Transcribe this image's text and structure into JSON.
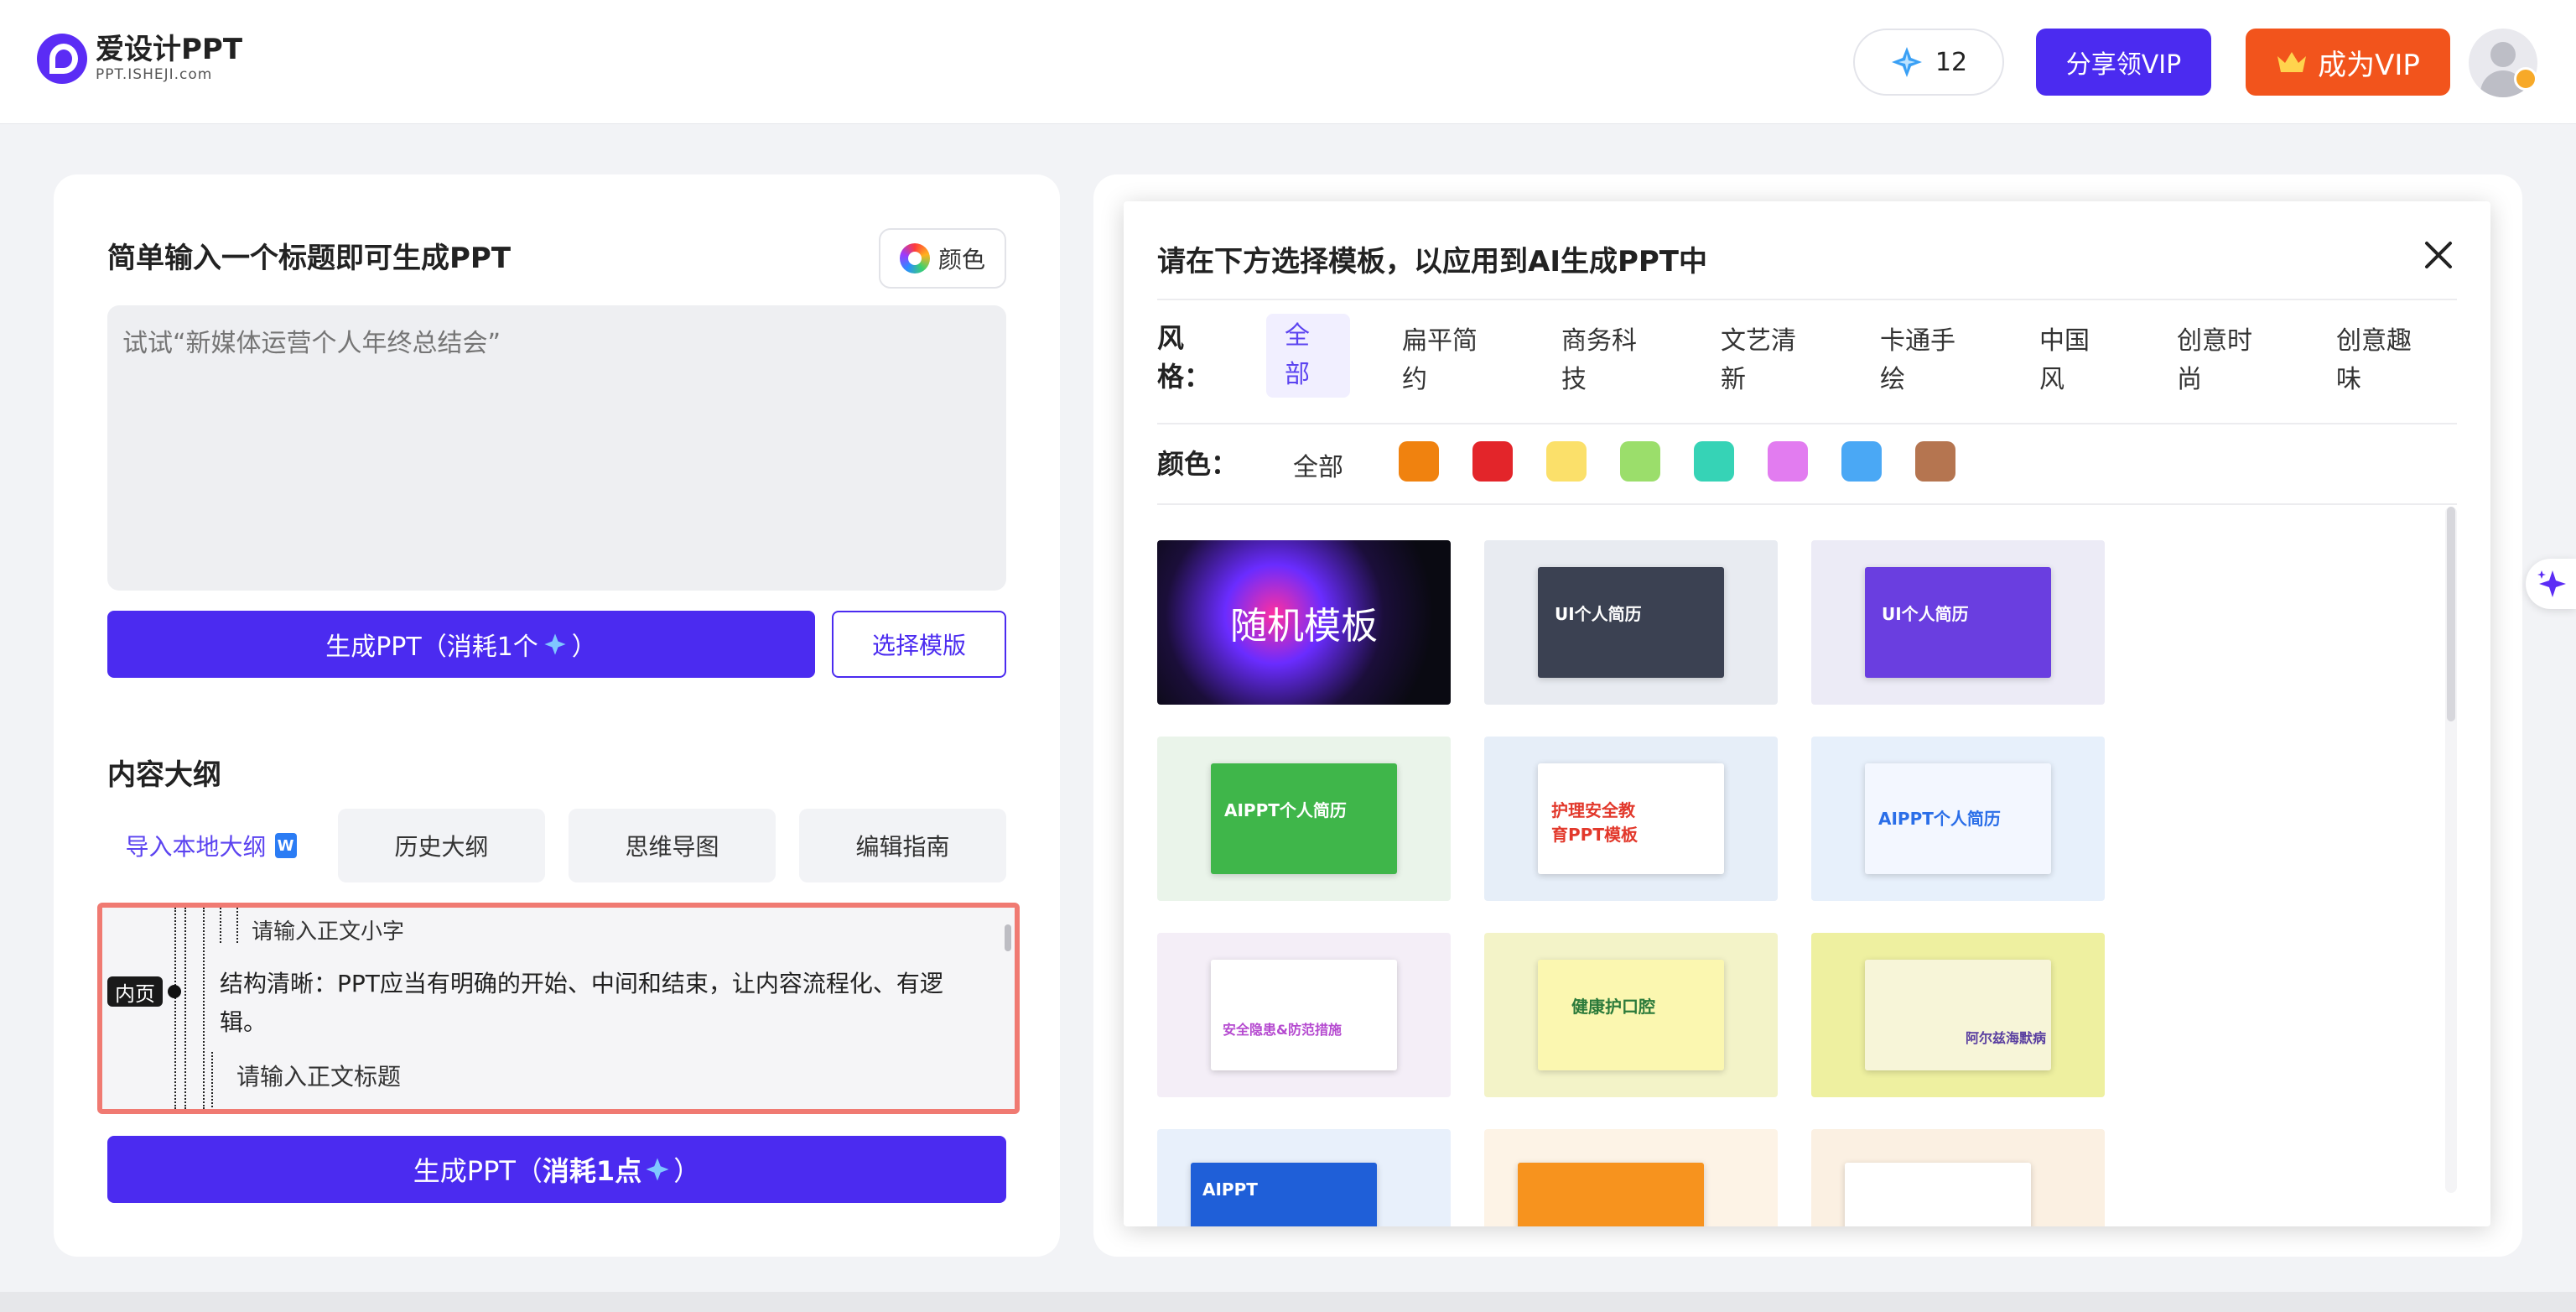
{
  "header": {
    "logo_cn": "爱设计PPT",
    "logo_en": "PPT.ISHEJI.com",
    "credits": "12",
    "share_button": "分享领VIP",
    "vip_button": "成为VIP"
  },
  "left": {
    "title": "简单输入一个标题即可生成PPT",
    "color_button": "颜色",
    "input_placeholder": "试试“新媒体运营个人年终总结会”",
    "generate_button": "生成PPT（消耗1个",
    "generate_button_tail": "）",
    "template_button": "选择模版",
    "outline_title": "内容大纲",
    "tabs": [
      {
        "label": "导入本地大纲"
      },
      {
        "label": "历史大纲"
      },
      {
        "label": "思维导图"
      },
      {
        "label": "编辑指南"
      }
    ],
    "outline": {
      "line1": "请输入正文小字",
      "line2": "结构清晰：PPT应当有明确的开始、中间和结束，让内容流程化、有逻辑。",
      "line3": "请输入正文标题",
      "badge": "内页"
    },
    "generate_button2": "生成PPT（",
    "generate_button2_bold": "消耗1点",
    "generate_button2_tail": "）"
  },
  "modal": {
    "title": "请在下方选择模板，以应用到AI生成PPT中",
    "style_label": "风格：",
    "styles": [
      "全部",
      "扁平简约",
      "商务科技",
      "文艺清新",
      "卡通手绘",
      "中国风",
      "创意时尚",
      "创意趣味"
    ],
    "color_label": "颜色：",
    "color_all": "全部",
    "colors": [
      "#f0820f",
      "#e3252a",
      "#fbe06a",
      "#9bde6b",
      "#36d3b6",
      "#e27cf0",
      "#4aa8f5",
      "#b57550"
    ],
    "random_template": "随机模板",
    "templates": [
      {
        "label": "UI个人简历"
      },
      {
        "label": "UI个人简历"
      },
      {
        "label": "AIPPT个人简历"
      },
      {
        "label": "护理安全教育PPT模板"
      },
      {
        "label": "AIPPT个人简历"
      },
      {
        "label": "安全隐患&防范措施"
      },
      {
        "label": "健康护口腔"
      },
      {
        "label": "阿尔兹海默病"
      },
      {
        "label": "AIPPT"
      },
      {
        "label": ""
      },
      {
        "label": ""
      }
    ]
  }
}
